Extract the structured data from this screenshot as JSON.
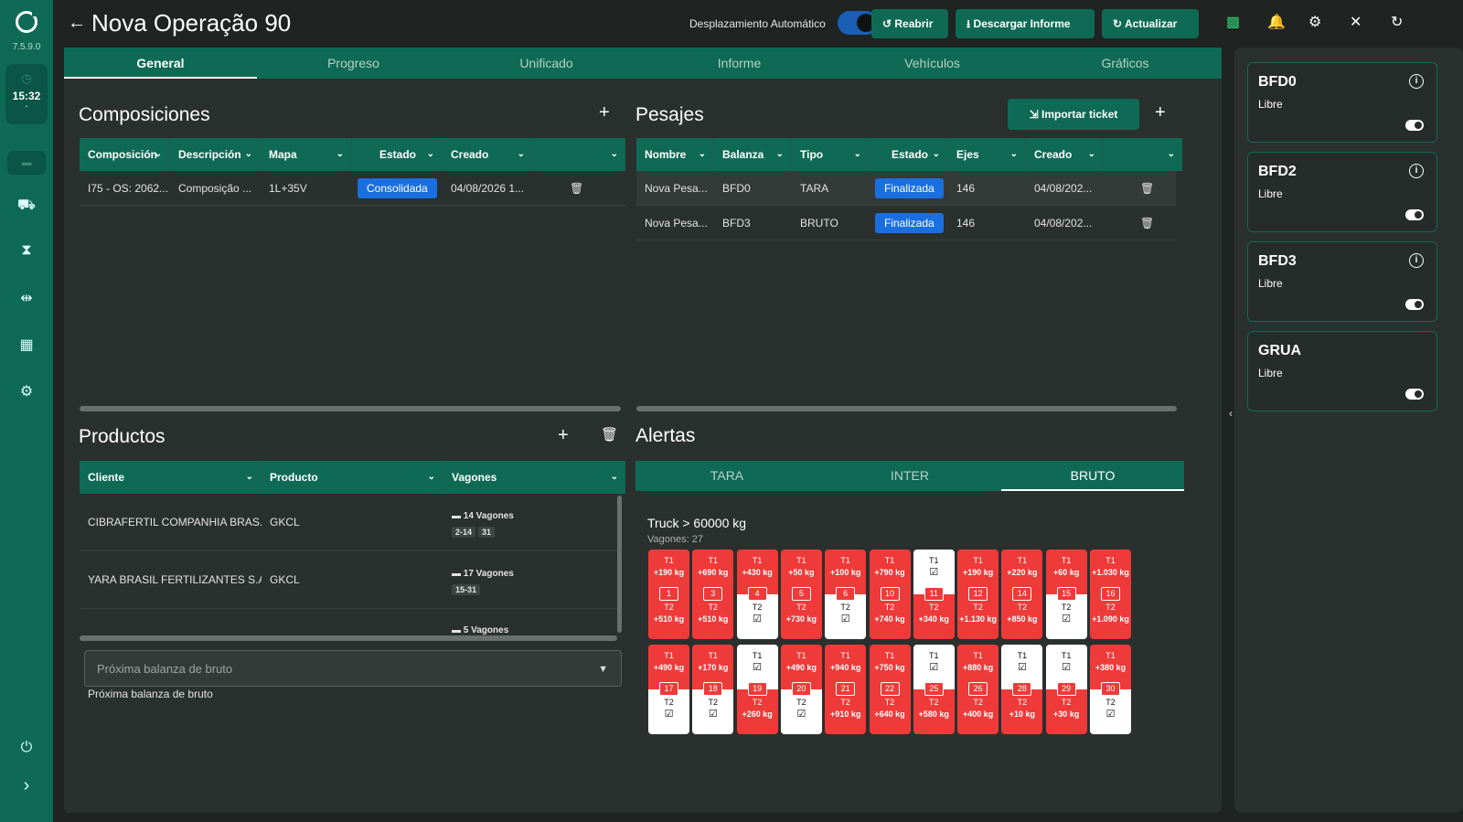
{
  "app": {
    "version": "7.5.9.0",
    "clock": "15:32",
    "title": "Nova Operação 90"
  },
  "header": {
    "auto_scroll_label": "Desplazamiento Automático",
    "reopen": "Reabrir",
    "download": "Descargar Informe",
    "update": "Actualizar"
  },
  "tabs": [
    "General",
    "Progreso",
    "Unificado",
    "Informe",
    "Vehículos",
    "Gráficos"
  ],
  "composiciones": {
    "title": "Composiciones",
    "columns": [
      "Composición",
      "Descripción",
      "Mapa",
      "Estado",
      "Creado",
      ""
    ],
    "rows": [
      {
        "composicion": "I75 - OS: 2062...",
        "descripcion": "Composição ...",
        "mapa": "1L+35V",
        "estado": "Consolidada",
        "creado": "04/08/2026 1..."
      }
    ]
  },
  "pesajes": {
    "title": "Pesajes",
    "import": "Importar ticket",
    "columns": [
      "Nombre",
      "Balanza",
      "Tipo",
      "Estado",
      "Ejes",
      "Creado",
      ""
    ],
    "rows": [
      {
        "nombre": "Nova Pesa...",
        "balanza": "BFD0",
        "tipo": "TARA",
        "estado": "Finalizada",
        "ejes": "146",
        "creado": "04/08/202..."
      },
      {
        "nombre": "Nova Pesa...",
        "balanza": "BFD3",
        "tipo": "BRUTO",
        "estado": "Finalizada",
        "ejes": "146",
        "creado": "04/08/202..."
      }
    ]
  },
  "productos": {
    "title": "Productos",
    "columns": [
      "Cliente",
      "Producto",
      "Vagones"
    ],
    "rows": [
      {
        "cliente": "CIBRAFERTIL COMPANHIA BRAS...",
        "producto": "GKCL",
        "vagones": "14 Vagones",
        "chips": [
          "2-14",
          "31"
        ]
      },
      {
        "cliente": "YARA BRASIL FERTILIZANTES S.A.",
        "producto": "GKCL",
        "vagones": "17 Vagones",
        "chips": [
          "15-31"
        ]
      },
      {
        "cliente": "",
        "producto": "",
        "vagones": "5 Vagones",
        "chips": []
      }
    ],
    "select_placeholder": "Próxima balanza de bruto",
    "select_help": "Próxima balanza de bruto"
  },
  "alertas": {
    "title": "Alertas",
    "tabs": [
      "TARA",
      "INTER",
      "BRUTO"
    ],
    "truck": "Truck > 60000 kg",
    "vagones": "Vagones: 27",
    "wagons": [
      {
        "n": "1",
        "t1": "+190 kg",
        "t2": "+510 kg"
      },
      {
        "n": "3",
        "t1": "+690 kg",
        "t2": "+510 kg"
      },
      {
        "n": "4",
        "t1": "+430 kg",
        "t2": "ok"
      },
      {
        "n": "5",
        "t1": "+50 kg",
        "t2": "+730 kg"
      },
      {
        "n": "6",
        "t1": "+100 kg",
        "t2": "ok"
      },
      {
        "n": "10",
        "t1": "+790 kg",
        "t2": "+740 kg"
      },
      {
        "n": "11",
        "t1": "ok",
        "t2": "+340 kg"
      },
      {
        "n": "12",
        "t1": "+190 kg",
        "t2": "+1.130 kg"
      },
      {
        "n": "14",
        "t1": "+220 kg",
        "t2": "+850 kg"
      },
      {
        "n": "15",
        "t1": "+60 kg",
        "t2": "ok"
      },
      {
        "n": "16",
        "t1": "+1.030 kg",
        "t2": "+1.090 kg"
      },
      {
        "n": "17",
        "t1": "+490 kg",
        "t2": "ok"
      },
      {
        "n": "18",
        "t1": "+170 kg",
        "t2": "ok"
      },
      {
        "n": "19",
        "t1": "ok",
        "t2": "+260 kg"
      },
      {
        "n": "20",
        "t1": "+490 kg",
        "t2": "ok"
      },
      {
        "n": "21",
        "t1": "+940 kg",
        "t2": "+910 kg"
      },
      {
        "n": "22",
        "t1": "+750 kg",
        "t2": "+640 kg"
      },
      {
        "n": "25",
        "t1": "ok",
        "t2": "+580 kg"
      },
      {
        "n": "26",
        "t1": "+880 kg",
        "t2": "+400 kg"
      },
      {
        "n": "28",
        "t1": "ok",
        "t2": "+10 kg"
      },
      {
        "n": "29",
        "t1": "ok",
        "t2": "+30 kg"
      },
      {
        "n": "30",
        "t1": "+380 kg",
        "t2": "ok"
      }
    ]
  },
  "scales": [
    {
      "name": "BFD0",
      "status": "Libre"
    },
    {
      "name": "BFD2",
      "status": "Libre"
    },
    {
      "name": "BFD3",
      "status": "Libre"
    },
    {
      "name": "GRUA",
      "status": "Libre"
    }
  ]
}
